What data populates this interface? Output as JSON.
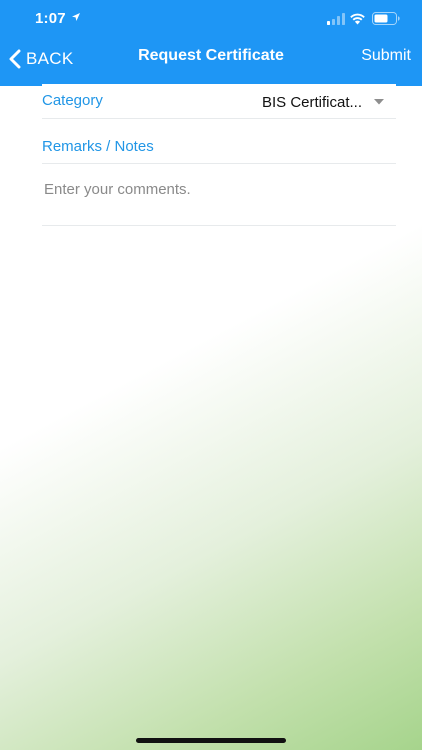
{
  "status_bar": {
    "time": "1:07",
    "icons": [
      "location-arrow-icon",
      "signal-icon",
      "wifi-icon",
      "battery-icon"
    ]
  },
  "nav": {
    "back_label": "BACK",
    "title": "Request Certificate",
    "submit_label": "Submit"
  },
  "form": {
    "category_label": "Category",
    "category_value": "BIS Certificat...",
    "remarks_label": "Remarks / Notes",
    "comments_placeholder": "Enter your comments."
  },
  "colors": {
    "header": "#1e96f5",
    "label": "#2196e6",
    "gradient_end": "#a6d48c"
  }
}
